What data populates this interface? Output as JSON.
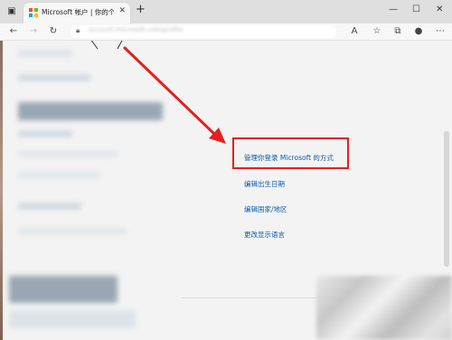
{
  "browser": {
    "tab": {
      "title": "Microsoft 帐户 | 你的个人档案 | Mi...",
      "close_glyph": "✕"
    },
    "new_tab_glyph": "+",
    "window_controls": [
      "—",
      "☐",
      "✕"
    ],
    "address_placeholder": "account.microsoft.com/profile"
  },
  "colors": {
    "highlight": "#e3201d",
    "link": "#0b5cab",
    "ms_logo": [
      "#f25022",
      "#7fba00",
      "#00a4ef",
      "#ffb900"
    ]
  },
  "icons": {
    "tab_actions": "tab-actions-icon",
    "back": "back-arrow-icon",
    "forward": "forward-arrow-icon",
    "refresh": "refresh-icon",
    "lock": "lock-icon",
    "read_aloud": "read-aloud-icon",
    "favorites": "favorites-icon",
    "collections": "collections-icon",
    "profile": "profile-icon",
    "more": "more-icon"
  },
  "profile_links": [
    "管理你登录 Microsoft 的方式",
    "编辑出生日期",
    "编辑国家/地区",
    "更改显示语言"
  ]
}
